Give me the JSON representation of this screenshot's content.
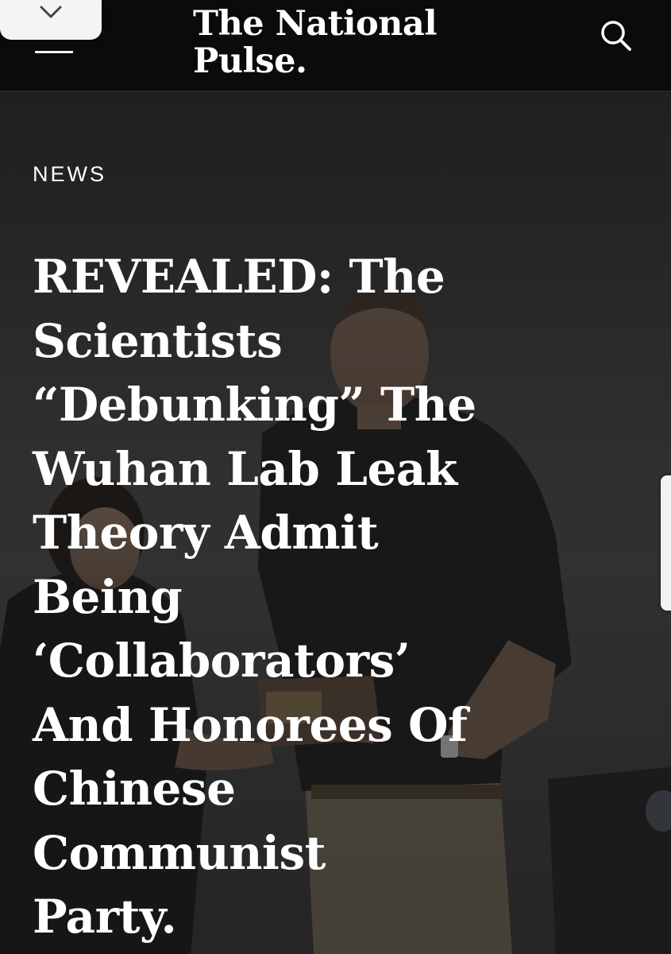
{
  "header": {
    "brand_line1": "The National",
    "brand_line2": "Pulse.",
    "background": "#0b0b0b",
    "text_color": "#ffffff",
    "icons": {
      "collapse": "chevron-down-icon",
      "menu": "menu-icon",
      "search": "search-icon"
    }
  },
  "article": {
    "category": "NEWS",
    "headline_lines": [
      "REVEALED: The",
      "Scientists",
      "“Debunking” The",
      "Wuhan Lab Leak",
      "Theory Admit",
      "Being",
      "‘Collaborators’",
      "And Honorees Of",
      "Chinese",
      "Communist",
      "Party."
    ]
  }
}
